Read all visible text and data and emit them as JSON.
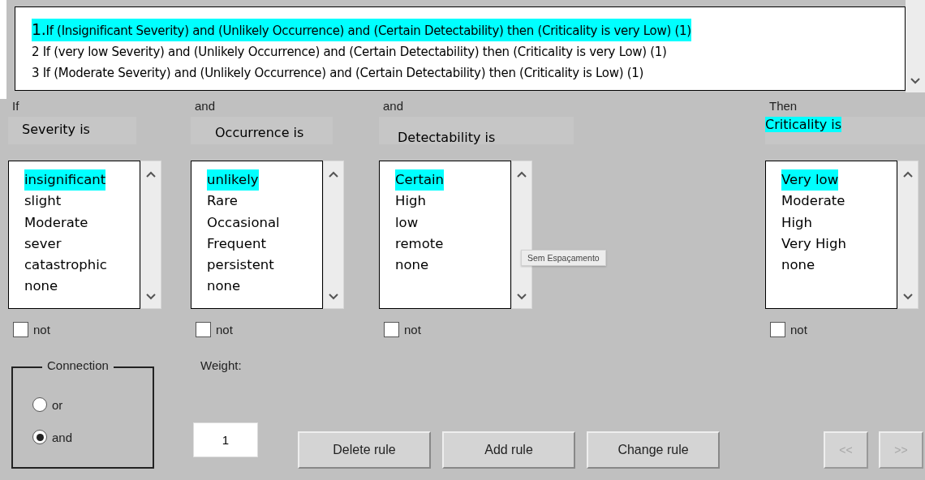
{
  "rules": [
    {
      "number": "1.",
      "text": "If (Insignificant Severity) and (Unlikely Occurrence) and (Certain Detectability) then (Criticality is very Low) (1)",
      "selected": true
    },
    {
      "text": "2 If (very low Severity) and (Unlikely Occurrence) and (Certain Detectability) then (Criticality is very Low) (1)",
      "selected": false
    },
    {
      "text": "3 If (Moderate Severity) and (Unlikely Occurrence) and (Certain Detectability) then (Criticality is Low) (1)",
      "selected": false
    }
  ],
  "columns": [
    {
      "operator": "If",
      "title": "Severity is",
      "title_highlighted": false,
      "items": [
        {
          "label": "insignificant",
          "selected": true
        },
        {
          "label": "slight",
          "selected": false
        },
        {
          "label": "Moderate",
          "selected": false
        },
        {
          "label": "sever",
          "selected": false
        },
        {
          "label": "catastrophic",
          "selected": false
        },
        {
          "label": "none",
          "selected": false
        }
      ],
      "not_label": "not",
      "not_checked": false
    },
    {
      "operator": "and",
      "title": "Occurrence is",
      "title_highlighted": false,
      "items": [
        {
          "label": "unlikely",
          "selected": true
        },
        {
          "label": "Rare",
          "selected": false
        },
        {
          "label": "Occasional",
          "selected": false
        },
        {
          "label": "Frequent",
          "selected": false
        },
        {
          "label": "persistent",
          "selected": false
        },
        {
          "label": "none",
          "selected": false
        }
      ],
      "not_label": "not",
      "not_checked": false
    },
    {
      "operator": "and",
      "title": "Detectability is",
      "title_highlighted": false,
      "items": [
        {
          "label": "Certain",
          "selected": true
        },
        {
          "label": "High",
          "selected": false
        },
        {
          "label": "low",
          "selected": false
        },
        {
          "label": "remote",
          "selected": false
        },
        {
          "label": "none",
          "selected": false
        }
      ],
      "not_label": "not",
      "not_checked": false,
      "tooltip": "Sem Espaçamento"
    },
    {
      "operator": "Then",
      "title": "Criticality is",
      "title_highlighted": true,
      "items": [
        {
          "label": "Very low",
          "selected": true
        },
        {
          "label": "Moderate",
          "selected": false
        },
        {
          "label": "High",
          "selected": false
        },
        {
          "label": "Very High",
          "selected": false
        },
        {
          "label": "none",
          "selected": false
        }
      ],
      "not_label": "not",
      "not_checked": false
    }
  ],
  "connection": {
    "title": "Connection",
    "options": [
      {
        "label": "or",
        "selected": false
      },
      {
        "label": "and",
        "selected": true
      }
    ]
  },
  "weight": {
    "label": "Weight:",
    "value": "1"
  },
  "buttons": [
    {
      "label": "Delete rule",
      "disabled": false
    },
    {
      "label": "Add rule",
      "disabled": false
    },
    {
      "label": "Change rule",
      "disabled": false
    }
  ],
  "nav_buttons": [
    {
      "label": "<<",
      "disabled": true
    },
    {
      "label": ">>",
      "disabled": true
    }
  ]
}
